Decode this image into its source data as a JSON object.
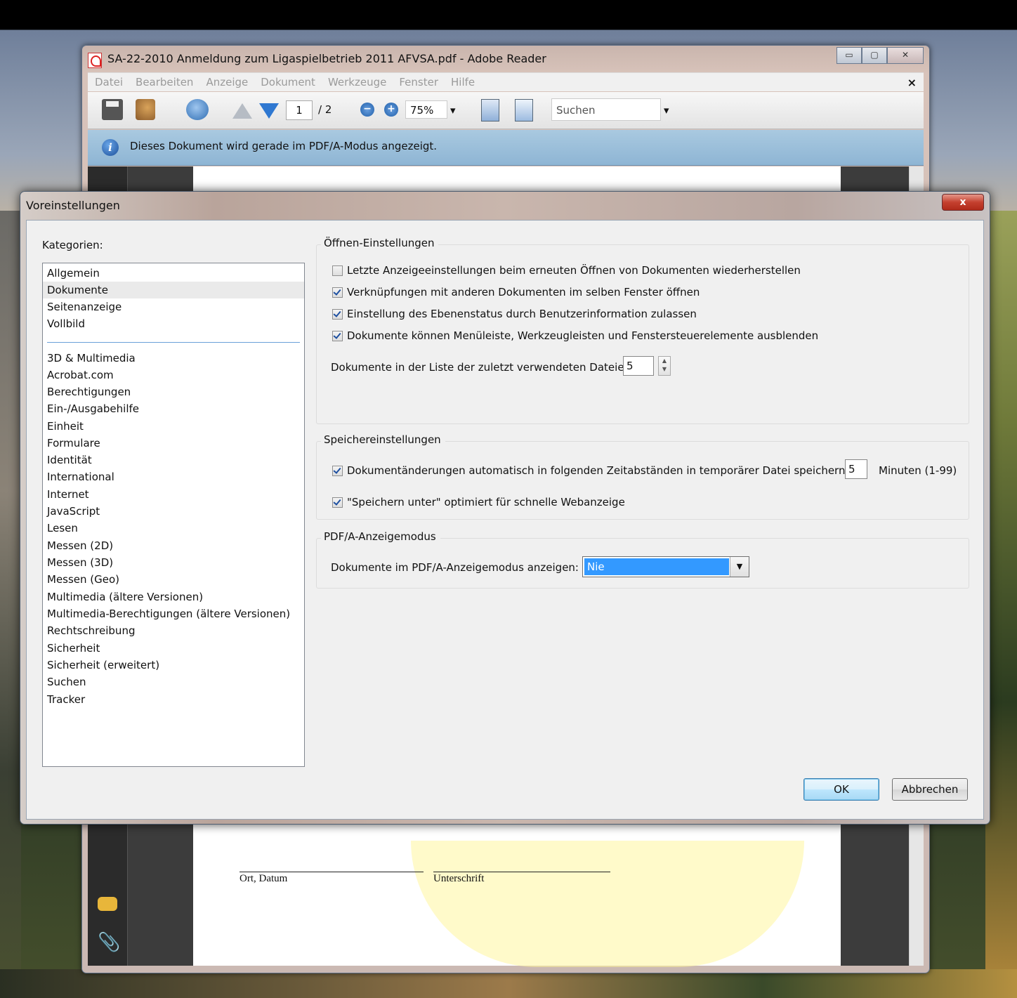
{
  "reader": {
    "title": "SA-22-2010 Anmeldung zum Ligaspielbetrieb 2011 AFVSA.pdf - Adobe Reader",
    "window_buttons": [
      "▭",
      "▢",
      "✕"
    ],
    "menu": [
      "Datei",
      "Bearbeiten",
      "Anzeige",
      "Dokument",
      "Werkzeuge",
      "Fenster",
      "Hilfe"
    ],
    "menu_close": "×",
    "toolbar": {
      "page_current": "1",
      "page_total": "/ 2",
      "zoom_out": "−",
      "zoom_in": "+",
      "zoom": "75%",
      "dropdown_arrow": "▾",
      "search_placeholder": "Suchen"
    },
    "info_icon": "i",
    "info_message": "Dieses Dokument wird gerade im PDF/A-Modus angezeigt.",
    "document": {
      "sig_place": "Ort, Datum",
      "sig_signature": "Unterschrift"
    },
    "clip_glyph": "📎"
  },
  "dialog": {
    "title": "Voreinstellungen",
    "close": "x",
    "categories_label": "Kategorien:",
    "categories_top": [
      "Allgemein",
      "Dokumente",
      "Seitenanzeige",
      "Vollbild"
    ],
    "selected_category": "Dokumente",
    "categories_bottom": [
      "3D & Multimedia",
      "Acrobat.com",
      "Berechtigungen",
      "Ein-/Ausgabehilfe",
      "Einheit",
      "Formulare",
      "Identität",
      "International",
      "Internet",
      "JavaScript",
      "Lesen",
      "Messen (2D)",
      "Messen (3D)",
      "Messen (Geo)",
      "Multimedia (ältere Versionen)",
      "Multimedia-Berechtigungen (ältere Versionen)",
      "Rechtschreibung",
      "Sicherheit",
      "Sicherheit (erweitert)",
      "Suchen",
      "Tracker"
    ],
    "open_settings": {
      "title": "Öffnen-Einstellungen",
      "options": [
        {
          "label": "Letzte Anzeigeeinstellungen beim erneuten Öffnen von Dokumenten wiederherstellen",
          "checked": false
        },
        {
          "label": "Verknüpfungen mit anderen Dokumenten im selben Fenster öffnen",
          "checked": true
        },
        {
          "label": "Einstellung des Ebenenstatus durch Benutzerinformation zulassen",
          "checked": true
        },
        {
          "label": "Dokumente können Menüleiste, Werkzeugleisten und Fenstersteuerelemente ausblenden",
          "checked": true
        }
      ],
      "recent_label": "Dokumente in der Liste der zuletzt verwendeten Dateien:",
      "recent_value": "5",
      "spin_up": "▲",
      "spin_down": "▼"
    },
    "save_settings": {
      "title": "Speichereinstellungen",
      "autosave_label": "Dokumentänderungen automatisch in folgenden Zeitabständen in temporärer Datei speichern:",
      "autosave_checked": true,
      "autosave_value": "5",
      "autosave_unit": "Minuten (1-99)",
      "fastweb_label": "\"Speichern unter\" optimiert für schnelle Webanzeige",
      "fastweb_checked": true
    },
    "pdfa": {
      "title": "PDF/A-Anzeigemodus",
      "label": "Dokumente im PDF/A-Anzeigemodus anzeigen:",
      "value": "Nie",
      "arrow": "▼"
    },
    "ok": "OK",
    "cancel": "Abbrechen"
  }
}
